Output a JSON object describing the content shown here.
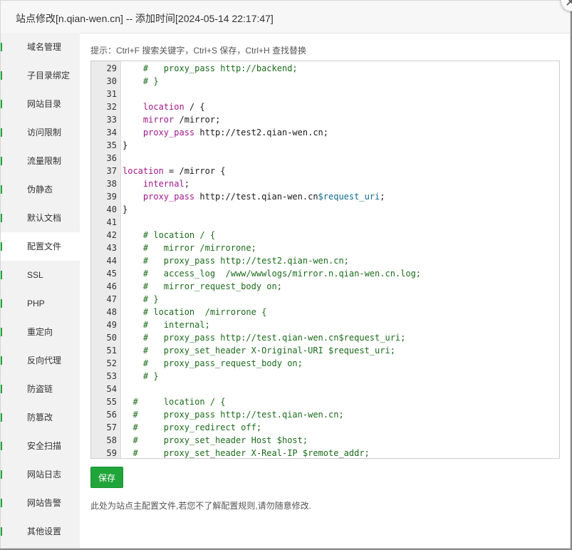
{
  "modal": {
    "title": "站点修改[n.qian-wen.cn] -- 添加时间[2024-05-14 22:17:47]"
  },
  "sidebar": {
    "items": [
      {
        "label": "域名管理"
      },
      {
        "label": "子目录绑定"
      },
      {
        "label": "网站目录"
      },
      {
        "label": "访问限制"
      },
      {
        "label": "流量限制"
      },
      {
        "label": "伪静态"
      },
      {
        "label": "默认文档"
      },
      {
        "label": "配置文件",
        "active": true
      },
      {
        "label": "SSL"
      },
      {
        "label": "PHP"
      },
      {
        "label": "重定向"
      },
      {
        "label": "反向代理"
      },
      {
        "label": "防盗链"
      },
      {
        "label": "防篡改"
      },
      {
        "label": "安全扫描"
      },
      {
        "label": "网站日志"
      },
      {
        "label": "网站告警"
      },
      {
        "label": "其他设置"
      }
    ]
  },
  "tips": "提示：Ctrl+F 搜索关键字，Ctrl+S 保存，Ctrl+H 查找替换",
  "editor": {
    "lines": [
      {
        "n": "29",
        "t": "    #   proxy_pass http://backend;"
      },
      {
        "n": "30",
        "t": "    # }"
      },
      {
        "n": "31",
        "t": ""
      },
      {
        "n": "32",
        "t": "    location / {"
      },
      {
        "n": "33",
        "t": "    mirror /mirror;"
      },
      {
        "n": "34",
        "t": "    proxy_pass http://test2.qian-wen.cn;"
      },
      {
        "n": "35",
        "t": "}"
      },
      {
        "n": "36",
        "t": ""
      },
      {
        "n": "37",
        "t": "location = /mirror {"
      },
      {
        "n": "38",
        "t": "    internal;"
      },
      {
        "n": "39",
        "t": "    proxy_pass http://test.qian-wen.cn$request_uri;"
      },
      {
        "n": "40",
        "t": "}"
      },
      {
        "n": "41",
        "t": ""
      },
      {
        "n": "42",
        "t": "    # location / {"
      },
      {
        "n": "43",
        "t": "    #   mirror /mirrorone;"
      },
      {
        "n": "44",
        "t": "    #   proxy_pass http://test2.qian-wen.cn;"
      },
      {
        "n": "45",
        "t": "    #   access_log  /www/wwwlogs/mirror.n.qian-wen.cn.log;"
      },
      {
        "n": "46",
        "t": "    #   mirror_request_body on;"
      },
      {
        "n": "47",
        "t": "    # }"
      },
      {
        "n": "48",
        "t": "    # location  /mirrorone {"
      },
      {
        "n": "49",
        "t": "    #   internal;"
      },
      {
        "n": "50",
        "t": "    #   proxy_pass http://test.qian-wen.cn$request_uri;"
      },
      {
        "n": "51",
        "t": "    #   proxy_set_header X-Original-URI $request_uri;"
      },
      {
        "n": "52",
        "t": "    #   proxy_pass_request_body on;"
      },
      {
        "n": "53",
        "t": "    # }"
      },
      {
        "n": "54",
        "t": ""
      },
      {
        "n": "55",
        "t": "  #     location / {"
      },
      {
        "n": "56",
        "t": "  #     proxy_pass http://test.qian-wen.cn;"
      },
      {
        "n": "57",
        "t": "  #     proxy_redirect off;"
      },
      {
        "n": "58",
        "t": "  #     proxy_set_header Host $host;"
      },
      {
        "n": "59",
        "t": "  #     proxy_set_header X-Real-IP $remote_addr;"
      }
    ]
  },
  "save_label": "保存",
  "note": "此处为站点主配置文件,若您不了解配置规则,请勿随意修改.",
  "colors": {
    "accent": "#20a53a",
    "keyword": "#a0168b",
    "comment": "#1b6b1b",
    "variable": "#0f6b8f"
  },
  "icons": {
    "close": "close-icon"
  }
}
